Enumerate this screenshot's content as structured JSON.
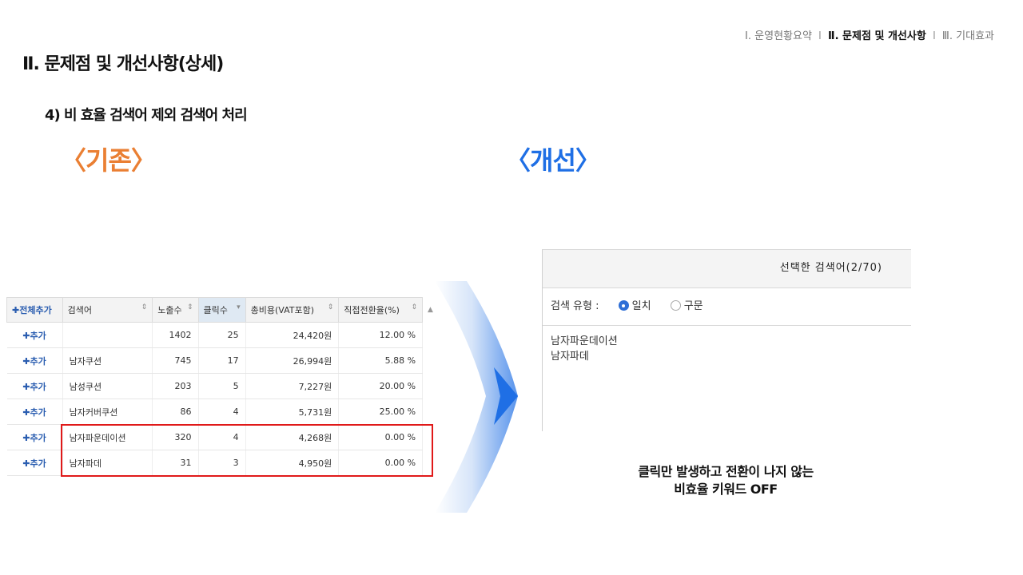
{
  "nav": {
    "item1": "Ⅰ. 운영현황요약",
    "sep1": "I",
    "item2": "Ⅱ. 문제점 및 개선사항",
    "sep2": "I",
    "item3": "Ⅲ. 기대효과"
  },
  "page_title": "Ⅱ. 문제점 및 개선사항(상세)",
  "subtitle": "4) 비 효율 검색어 제외 검색어 처리",
  "label_before": "〈기존〉",
  "label_after": "〈개선〉",
  "table": {
    "headers": {
      "add_all": "✚전체추가",
      "keyword": "검색어",
      "impressions": "노출수",
      "clicks": "클릭수",
      "cost": "총비용(VAT포함)",
      "conversion": "직접전환율(%)"
    },
    "sort_icon": "⇕",
    "sort_active_icon": "▾",
    "scroll_up": "▲",
    "add_label": "✚추가",
    "rows": [
      {
        "keyword": "",
        "impressions": "1402",
        "clicks": "25",
        "cost": "24,420원",
        "conversion": "12.00 %"
      },
      {
        "keyword": "남자쿠션",
        "impressions": "745",
        "clicks": "17",
        "cost": "26,994원",
        "conversion": "5.88 %"
      },
      {
        "keyword": "남성쿠션",
        "impressions": "203",
        "clicks": "5",
        "cost": "7,227원",
        "conversion": "20.00 %"
      },
      {
        "keyword": "남자커버쿠션",
        "impressions": "86",
        "clicks": "4",
        "cost": "5,731원",
        "conversion": "25.00 %"
      },
      {
        "keyword": "남자파운데이션",
        "impressions": "320",
        "clicks": "4",
        "cost": "4,268원",
        "conversion": "0.00 %"
      },
      {
        "keyword": "남자파데",
        "impressions": "31",
        "clicks": "3",
        "cost": "4,950원",
        "conversion": "0.00 %"
      }
    ]
  },
  "panel": {
    "header": "선택한 검색어(2/70)",
    "type_label": "검색 유형 :",
    "option_exact": "일치",
    "option_phrase": "구문",
    "keywords": [
      "남자파운데이션",
      "남자파데"
    ]
  },
  "caption": {
    "line1": "클릭만 발생하고 전환이 나지 않는",
    "line2": "비효율 키워드 OFF"
  },
  "colors": {
    "before": "#ea7f33",
    "after": "#1f6fe5",
    "highlight": "#e01919",
    "arrow": "#1f6fe5"
  }
}
